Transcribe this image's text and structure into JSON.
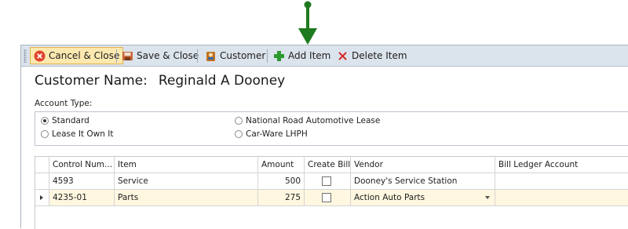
{
  "toolbar": {
    "cancel_close": "Cancel & Close",
    "save_close": "Save & Close",
    "customer": "Customer",
    "add_item": "Add Item",
    "delete_item": "Delete Item"
  },
  "customer": {
    "label": "Customer Name:",
    "name": "Reginald A Dooney"
  },
  "account_type": {
    "label": "Account Type:",
    "options": [
      "Standard",
      "National Road Automotive Lease",
      "Lease It Own It",
      "Car-Ware LHPH"
    ],
    "selected": "Standard"
  },
  "grid": {
    "columns": [
      "Control Num...",
      "Item",
      "Amount",
      "Create Bill",
      "Vendor",
      "Bill Ledger Account"
    ],
    "rows": [
      {
        "control": "4593",
        "item": "Service",
        "amount": "500",
        "create_bill": false,
        "vendor": "Dooney's Service Station",
        "ledger": ""
      },
      {
        "control": "4235-01",
        "item": "Parts",
        "amount": "275",
        "create_bill": false,
        "vendor": "Action Auto Parts",
        "ledger": ""
      }
    ],
    "selected_row": 1
  },
  "colors": {
    "annotation_arrow": "#1e7a1e",
    "toolbar_bg": "#dbe3ec",
    "selected_row_bg": "#fff7e0",
    "active_button_bg": "#fde9b0"
  },
  "icons": [
    "cancel-icon",
    "save-icon",
    "customer-icon",
    "add-icon",
    "delete-icon"
  ]
}
